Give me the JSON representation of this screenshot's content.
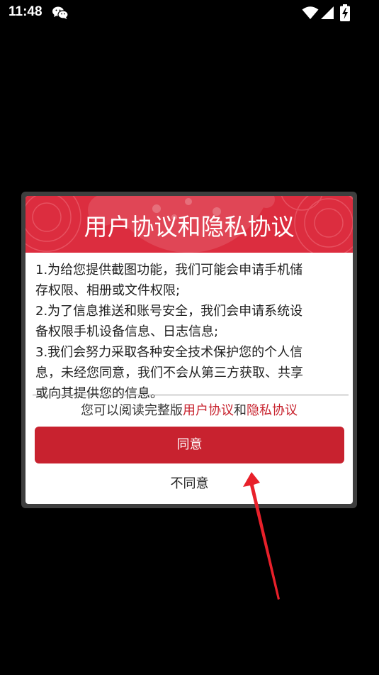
{
  "status_bar": {
    "time": "11:48",
    "icons": [
      "wechat-icon",
      "wifi-icon",
      "signal-icon",
      "battery-charging-icon"
    ]
  },
  "dialog": {
    "title": "用户协议和隐私协议",
    "body_lines": [
      "1.为给您提供截图功能，我们可能会申请手机储",
      "存权限、相册或文件权限;",
      "2.为了信息推送和账号安全，我们会申请系统设",
      "备权限手机设备信息、日志信息;",
      "3.我们会努力采取各种安全技术保护您的个人信",
      "息，未经您同意，我们不会从第三方获取、共享",
      "或向其提供您的信息。"
    ],
    "read_prefix": "您可以阅读完整版",
    "user_agreement_link": "用户协议",
    "read_and": "和",
    "privacy_link": "隐私协议",
    "agree_label": "同意",
    "disagree_label": "不同意"
  },
  "colors": {
    "header_red": "#dc2d3f",
    "button_red": "#c8222f",
    "link_red": "#c8242f",
    "annotation_arrow": "#e8202a"
  }
}
